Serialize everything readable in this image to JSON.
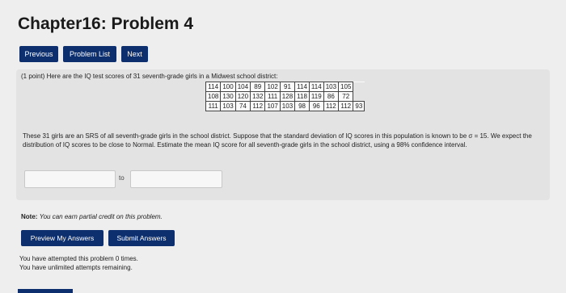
{
  "page": {
    "title": "Chapter16: Problem 4"
  },
  "nav": {
    "previous_label": "Previous",
    "problem_list_label": "Problem List",
    "next_label": "Next"
  },
  "problem": {
    "intro": "(1 point) Here are the IQ test scores of 31 seventh-grade girls in a Midwest school district:",
    "scores": [
      [
        "114",
        "100",
        "104",
        "89",
        "102",
        "91",
        "114",
        "114",
        "103",
        "105"
      ],
      [
        "108",
        "130",
        "120",
        "132",
        "111",
        "128",
        "118",
        "119",
        "86",
        "72"
      ],
      [
        "111",
        "103",
        "74",
        "112",
        "107",
        "103",
        "98",
        "96",
        "112",
        "112",
        "93"
      ]
    ],
    "paragraph": "These 31 girls are an SRS of all seventh-grade girls in the school district. Suppose that the standard deviation of IQ scores in this population is known to be σ = 15. We expect the distribution of IQ scores to be close to Normal. Estimate the mean IQ score for all seventh-grade girls in the school district, using a 98% confidence interval.",
    "to_label": "to",
    "lower_value": "",
    "upper_value": ""
  },
  "note": {
    "label": "Note:",
    "text": "You can earn partial credit on this problem."
  },
  "actions": {
    "preview_label": "Preview My Answers",
    "submit_label": "Submit Answers"
  },
  "status": {
    "attempted": "You have attempted this problem 0 times.",
    "remaining": "You have unlimited attempts remaining."
  }
}
